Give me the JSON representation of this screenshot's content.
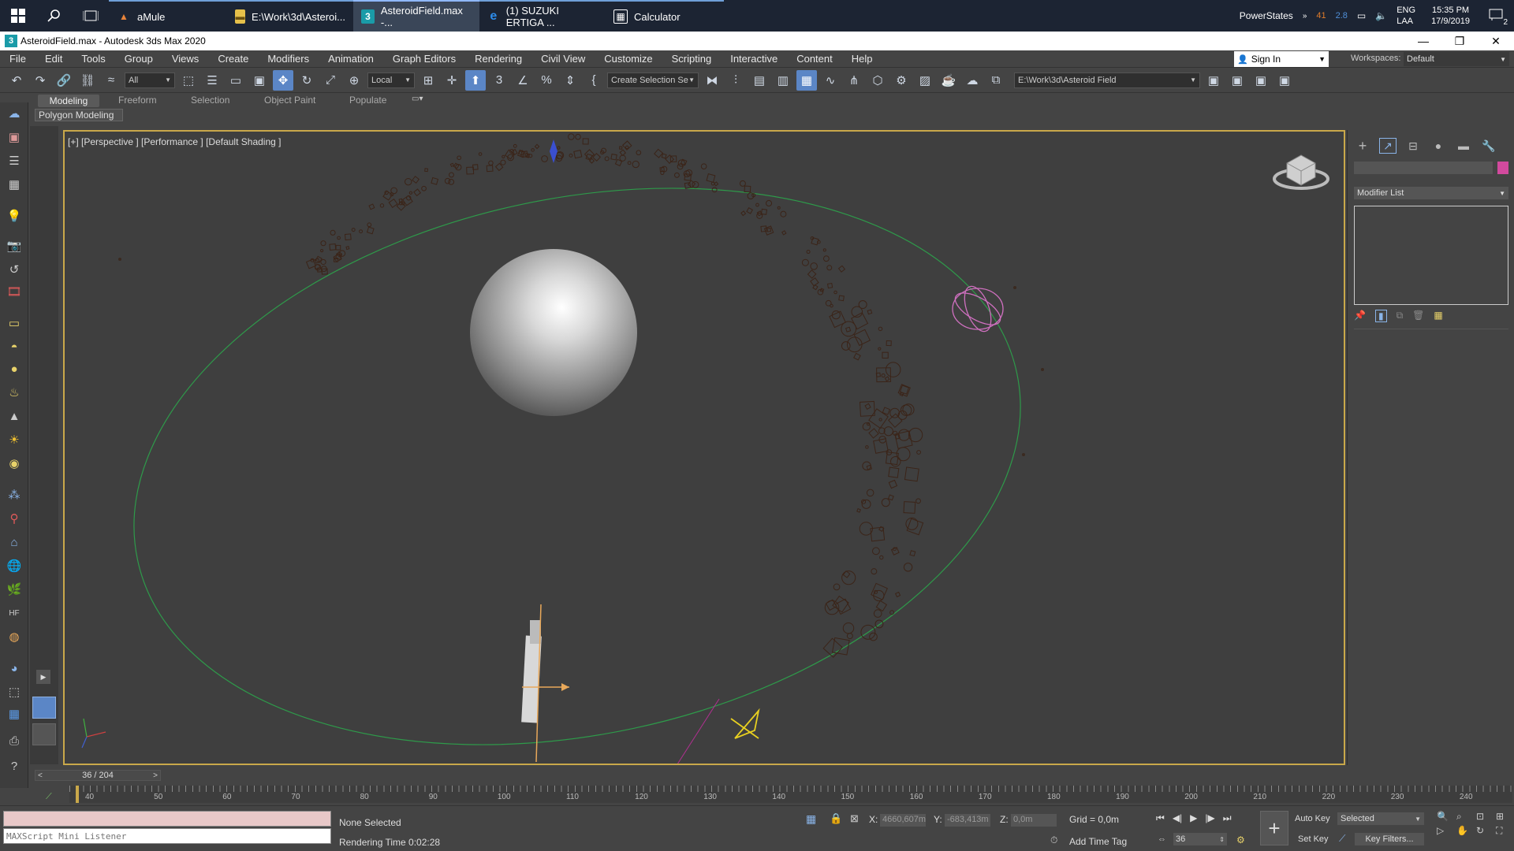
{
  "taskbar": {
    "tasks": [
      {
        "label": "aMule",
        "icon": "amule-icon"
      },
      {
        "label": "E:\\Work\\3d\\Asteroi...",
        "icon": "folder-icon"
      },
      {
        "label": "AsteroidField.max -...",
        "icon": "3dsmax-icon"
      },
      {
        "label": "(1) SUZUKI ERTIGA ...",
        "icon": "edge-icon"
      },
      {
        "label": "Calculator",
        "icon": "calculator-icon"
      }
    ],
    "tray": {
      "powerstates": "PowerStates",
      "cpu_value": "41",
      "gpu_value": "2.8",
      "lang": "ENG",
      "lang2": "LAA",
      "time": "15:35 PM",
      "date": "17/9/2019",
      "notif_count": "2"
    }
  },
  "titlebar": {
    "title": "AsteroidField.max - Autodesk 3ds Max 2020"
  },
  "menus": [
    "File",
    "Edit",
    "Tools",
    "Group",
    "Views",
    "Create",
    "Modifiers",
    "Animation",
    "Graph Editors",
    "Rendering",
    "Civil View",
    "Customize",
    "Scripting",
    "Interactive",
    "Content",
    "Help"
  ],
  "account": {
    "sign_in": "Sign In",
    "workspaces_label": "Workspaces:",
    "workspace_value": "Default"
  },
  "toolbar": {
    "selection_filter": "All",
    "coord_system": "Local",
    "named_selection": "Create Selection Se",
    "project_path": "E:\\Work\\3d\\Asteroid Field"
  },
  "ribbon": {
    "tabs": [
      "Modeling",
      "Freeform",
      "Selection",
      "Object Paint",
      "Populate"
    ],
    "active_tab": "Modeling",
    "subpanel": "Polygon Modeling"
  },
  "viewport": {
    "label": "[+] [Perspective ] [Performance ] [Default Shading ]"
  },
  "right_panel": {
    "modifier_list": "Modifier List",
    "accent_color": "#d24a9e"
  },
  "timeline": {
    "frame_readout": "36 / 204",
    "ticks": [
      "40",
      "50",
      "60",
      "70",
      "80",
      "90",
      "100",
      "110",
      "120",
      "130",
      "140",
      "150",
      "160",
      "170",
      "180",
      "190",
      "200",
      "210",
      "220",
      "230",
      "240"
    ]
  },
  "status": {
    "maxscript_placeholder": "MAXScript Mini Listener",
    "selection_text": "None Selected",
    "rendering_time": "Rendering Time  0:02:28",
    "x_label": "X:",
    "x_value": "4660,607m",
    "y_label": "Y:",
    "y_value": "-683,413m",
    "z_label": "Z:",
    "z_value": "0,0m",
    "grid": "Grid = 0,0m",
    "add_time_tag": "Add Time Tag",
    "auto_key": "Auto Key",
    "set_key": "Set Key",
    "selected_value": "Selected",
    "key_filters": "Key Filters...",
    "current_frame": "36"
  }
}
